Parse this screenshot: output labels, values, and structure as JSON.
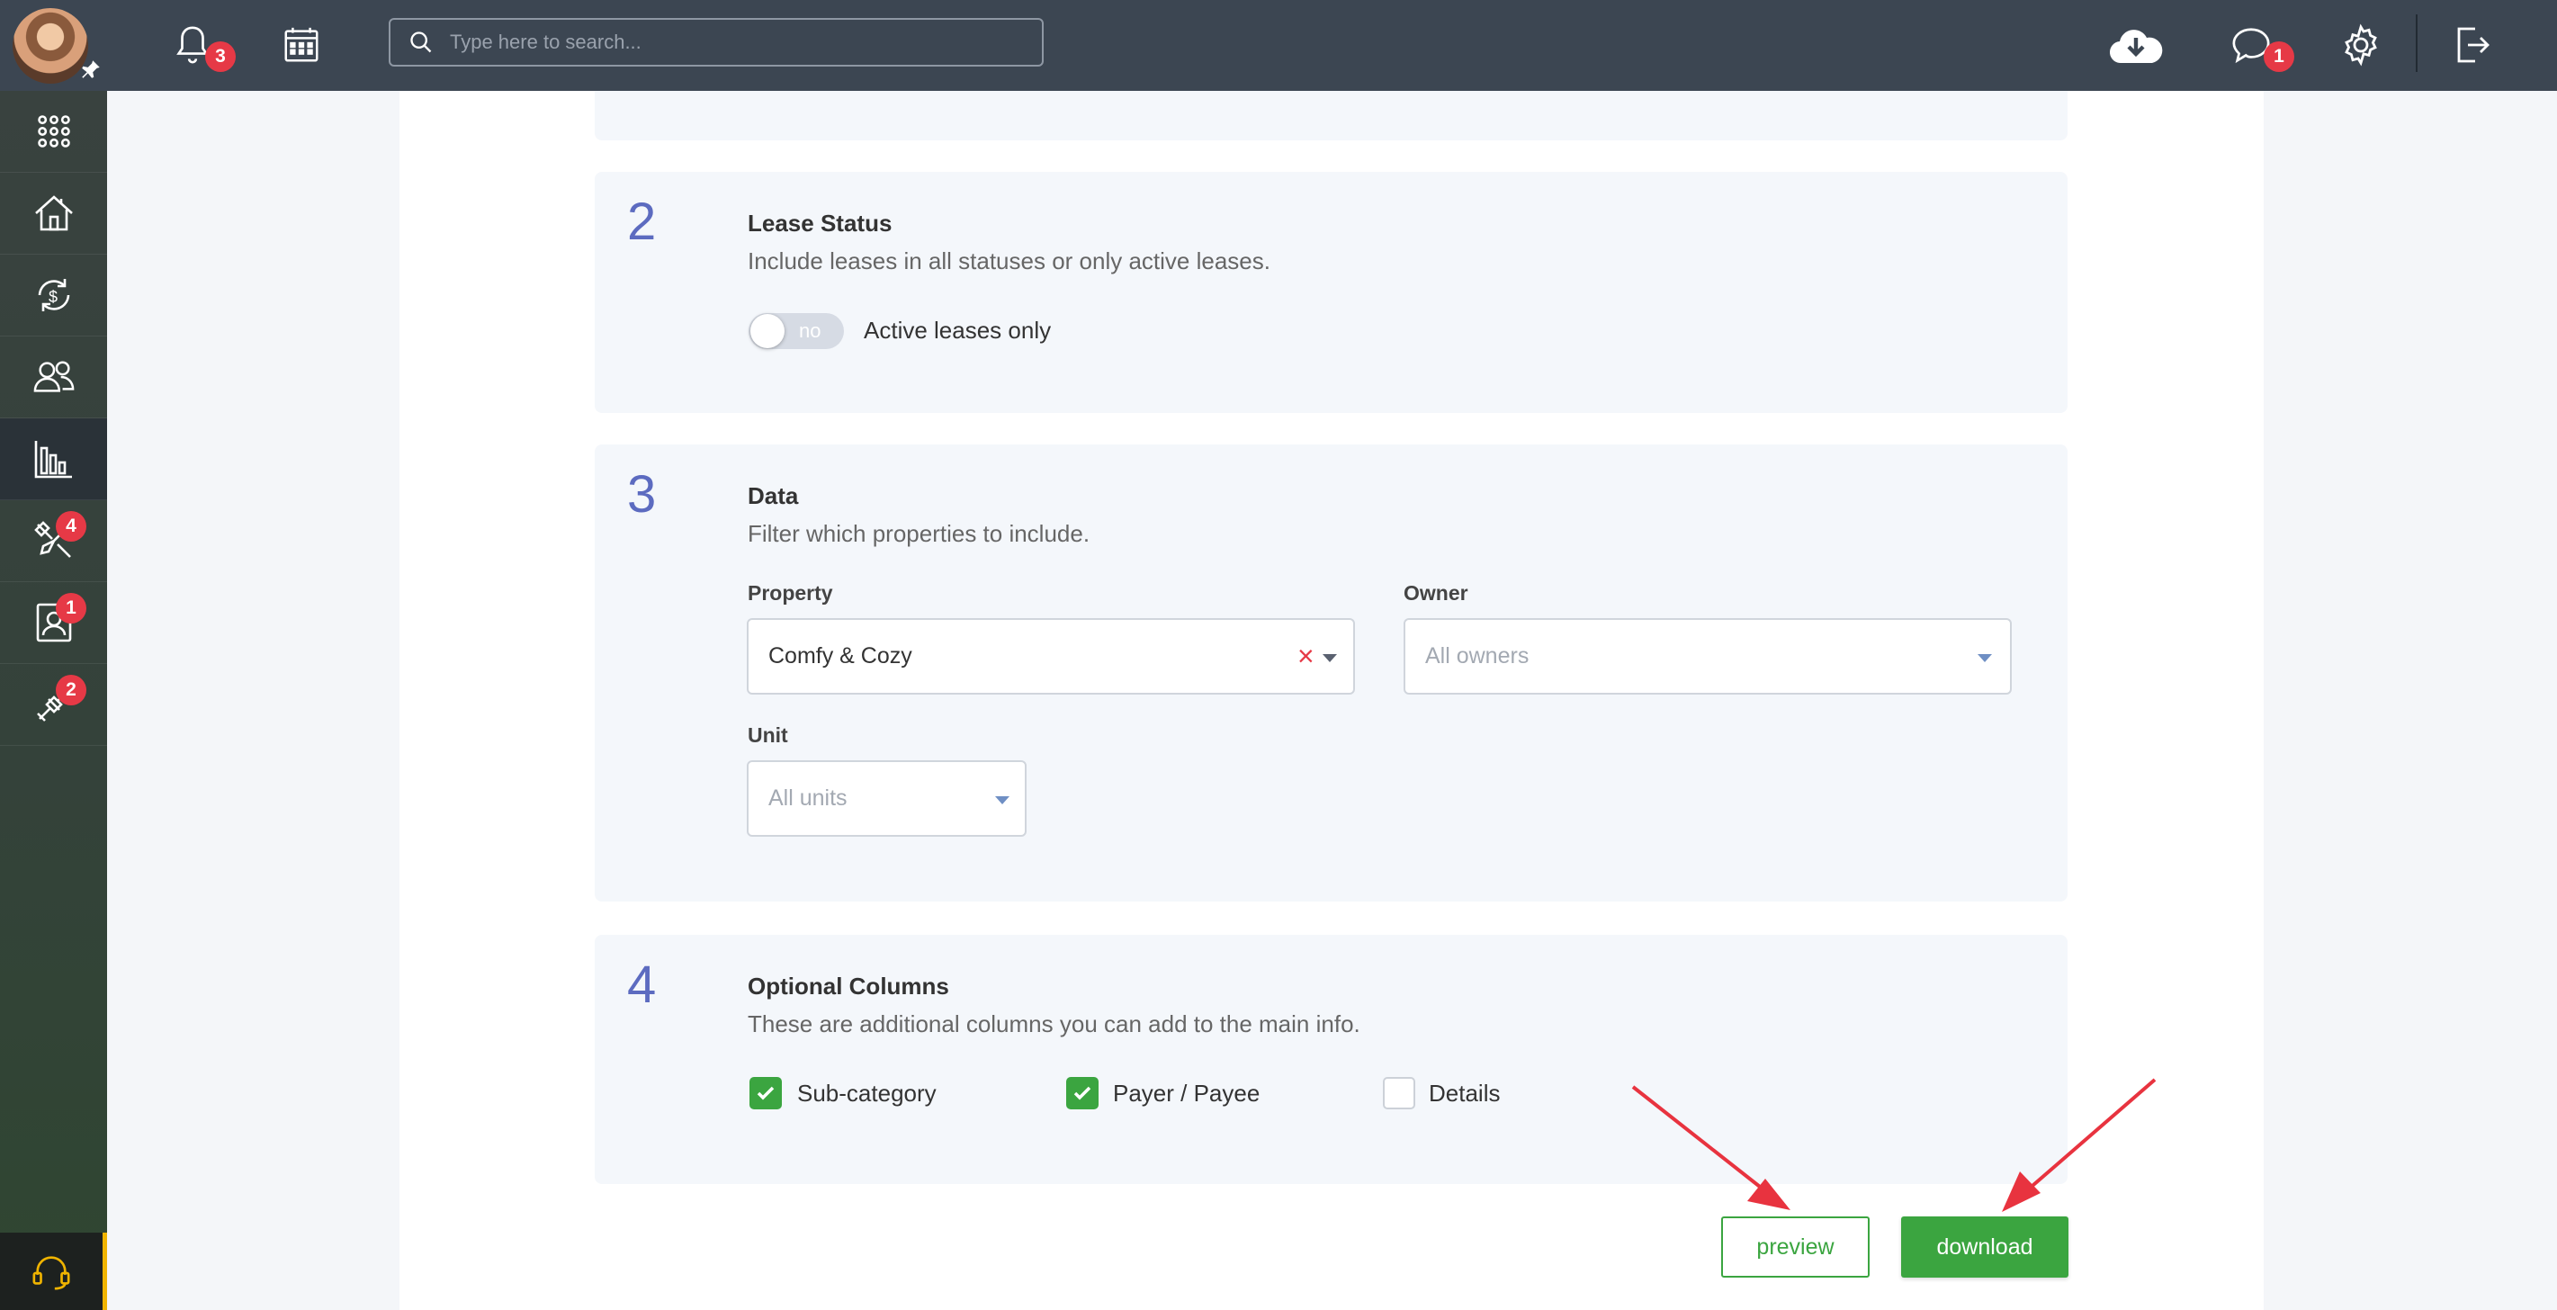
{
  "topbar": {
    "notifications_count": "3",
    "search_placeholder": "Type here to search...",
    "messages_count": "1",
    "icons": [
      "bell-icon",
      "calendar-icon",
      "search-icon",
      "cloud-download-icon",
      "chat-icon",
      "gear-icon",
      "logout-icon"
    ]
  },
  "sidebar": {
    "items": [
      {
        "icon": "apps-grid-icon",
        "badge": ""
      },
      {
        "icon": "property-icon",
        "badge": ""
      },
      {
        "icon": "payments-icon",
        "badge": ""
      },
      {
        "icon": "contacts-icon",
        "badge": ""
      },
      {
        "icon": "reports-icon",
        "badge": "",
        "active": true
      },
      {
        "icon": "maintenance-icon",
        "badge": "4"
      },
      {
        "icon": "tenant-screening-icon",
        "badge": "1"
      },
      {
        "icon": "integrations-icon",
        "badge": "2"
      }
    ],
    "support_icon": "headset-icon"
  },
  "sections": {
    "lease_status": {
      "number": "2",
      "title": "Lease Status",
      "description": "Include leases in all statuses or only active leases.",
      "toggle_state": "no",
      "toggle_label": "Active leases only"
    },
    "data": {
      "number": "3",
      "title": "Data",
      "description": "Filter which properties to include.",
      "property_label": "Property",
      "property_value": "Comfy & Cozy",
      "owner_label": "Owner",
      "owner_placeholder": "All owners",
      "unit_label": "Unit",
      "unit_placeholder": "All units"
    },
    "optional_columns": {
      "number": "4",
      "title": "Optional Columns",
      "description": "These are additional columns you can add to the main info.",
      "options": [
        {
          "label": "Sub-category",
          "checked": true
        },
        {
          "label": "Payer / Payee",
          "checked": true
        },
        {
          "label": "Details",
          "checked": false
        }
      ]
    }
  },
  "actions": {
    "preview_label": "preview",
    "download_label": "download"
  },
  "colors": {
    "topbar": "#3c4652",
    "accent_green": "#3ba540",
    "badge_red": "#e63946",
    "section_number": "#5c6bc0",
    "annotation_arrow": "#e8333f"
  }
}
